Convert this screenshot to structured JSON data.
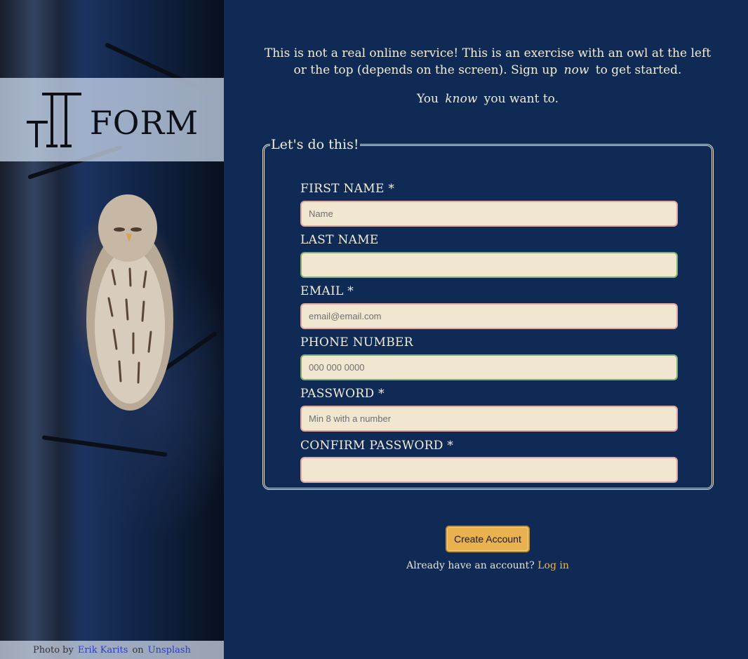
{
  "logo": {
    "text": "FORM"
  },
  "intro": {
    "line1_a": "This is not a real online service! This is an exercise with an owl at the left or the top (depends on the screen). Sign up",
    "line1_em": "now",
    "line1_b": "to get started.",
    "line2_a": "You",
    "line2_em": "know",
    "line2_b": "you want to."
  },
  "form": {
    "legend": "Let's do this!",
    "fields": [
      {
        "label": "FIRST NAME *",
        "placeholder": "Name",
        "value": ""
      },
      {
        "label": "LAST NAME",
        "placeholder": "",
        "value": ""
      },
      {
        "label": "EMAIL *",
        "placeholder": "email@email.com",
        "value": ""
      },
      {
        "label": "PHONE NUMBER",
        "placeholder": "000 000 0000",
        "value": ""
      },
      {
        "label": "PASSWORD *",
        "placeholder": "Min 8 with a number",
        "value": ""
      },
      {
        "label": "CONFIRM PASSWORD *",
        "placeholder": "",
        "value": ""
      }
    ],
    "submit_label": "Create Account"
  },
  "login": {
    "prompt": "Already have an account?",
    "link_label": "Log in"
  },
  "credit": {
    "prefix": "Photo by",
    "author": "Erik Karits",
    "on": "on",
    "site": "Unsplash"
  },
  "colors": {
    "background": "#0f2b55",
    "accent": "#e9b24f",
    "invalid_border": "#e2a6a6",
    "valid_border": "#86ad72",
    "input_bg": "#f1e7d1"
  }
}
